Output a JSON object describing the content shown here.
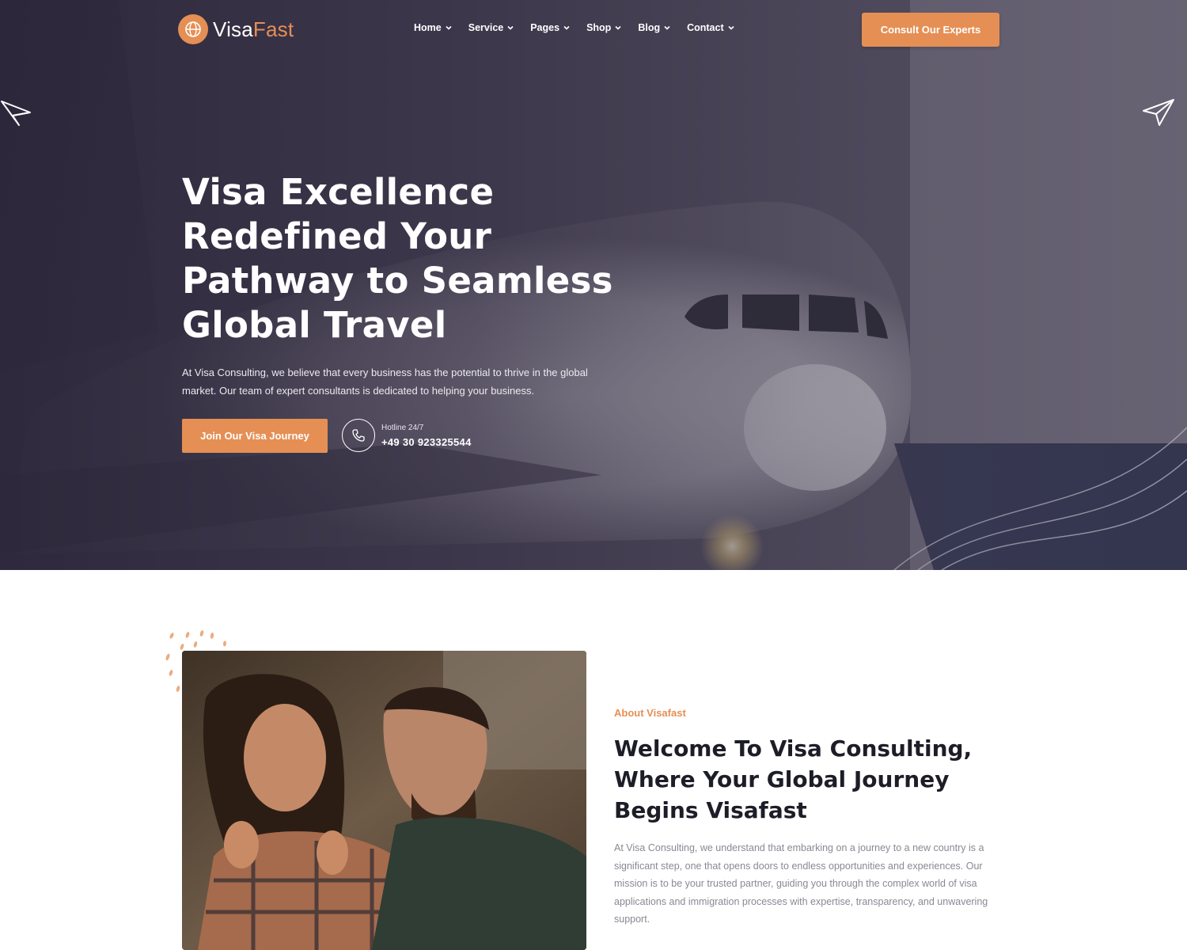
{
  "brand": {
    "name_part1": "Visa",
    "name_part2": "Fast",
    "accent_color": "#e58f55"
  },
  "nav": {
    "items": [
      {
        "label": "Home"
      },
      {
        "label": "Service"
      },
      {
        "label": "Pages"
      },
      {
        "label": "Shop"
      },
      {
        "label": "Blog"
      },
      {
        "label": "Contact"
      }
    ],
    "cta_label": "Consult Our Experts"
  },
  "hero": {
    "title": "Visa Excellence Redefined Your Pathway to Seamless Global Travel",
    "description": "At Visa Consulting, we believe that every business has the potential to thrive in the global market. Our team of expert consultants is dedicated to helping your business.",
    "primary_button": "Join Our Visa Journey",
    "hotline_label": "Hotline 24/7",
    "hotline_number": "+49 30 923325544"
  },
  "about": {
    "kicker": "About Visafast",
    "title": "Welcome To Visa Consulting, Where Your Global Journey Begins Visafast",
    "body": "At Visa Consulting, we understand that embarking on a journey to a new country is a significant step, one that opens doors to endless opportunities and experiences. Our mission is to be your trusted partner, guiding you through the complex world of visa applications and immigration processes with expertise, transparency, and unwavering support."
  },
  "icons": {
    "logo": "globe-icon",
    "menu_chevron": "chevron-down-icon",
    "phone": "phone-icon",
    "decor_planes": "paper-plane-icon"
  }
}
